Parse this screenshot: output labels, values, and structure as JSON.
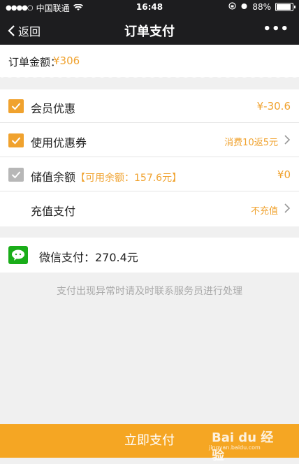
{
  "status_bar": {
    "carrier": "中国联通",
    "time": "16:48",
    "battery": "88%"
  },
  "nav": {
    "back_label": "返回",
    "title": "订单支付",
    "more": "•••"
  },
  "order": {
    "amount_label": "订单金额：",
    "amount_value": "¥306"
  },
  "options": [
    {
      "label": "会员优惠",
      "checked": true,
      "value": "¥-30.6"
    },
    {
      "label": "使用优惠券",
      "checked": true,
      "value": "消费10返5元"
    },
    {
      "label": "储值余额",
      "hint": "【可用余额：157.6元】",
      "checked": false,
      "value": "¥0"
    },
    {
      "label": "充值支付",
      "value": "不充值"
    }
  ],
  "wechat_pay": {
    "label": "微信支付：270.4元"
  },
  "notice": "支付出现异常时请及时联系服务员进行处理",
  "pay_button": "立即支付",
  "watermark": {
    "brand": "Bai du 经验",
    "url": "jingyan.baidu.com"
  },
  "colors": {
    "accent": "#f5a623",
    "nav_bg": "#1d1d1f",
    "wechat_green": "#1aad19"
  }
}
